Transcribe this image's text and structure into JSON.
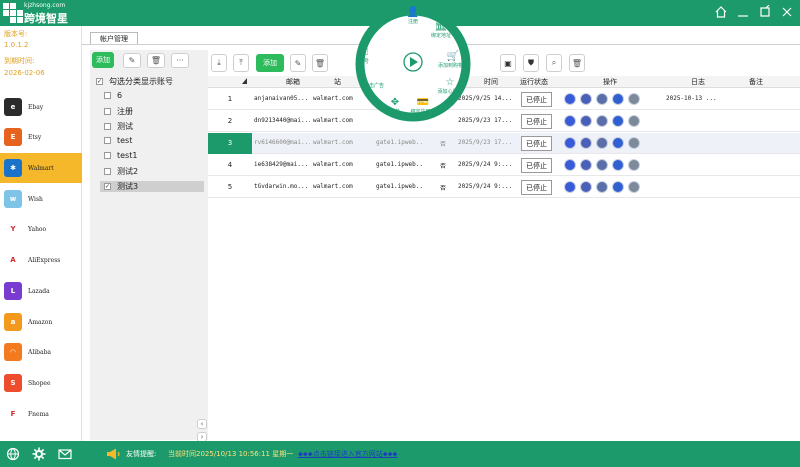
{
  "app": {
    "domain": "kjzhsong.com",
    "name": "跨境智星"
  },
  "version": {
    "label": "版本号:",
    "value": "1.0.1.2",
    "expire_label": "到期时间:",
    "expire_value": "2026-02-06"
  },
  "platforms": [
    {
      "name": "Ebay",
      "color": "#2b2b2b",
      "glyph": "e"
    },
    {
      "name": "Etsy",
      "color": "#e8621f",
      "glyph": "E"
    },
    {
      "name": "Walmart",
      "color": "#1a73c9",
      "glyph": "✱"
    },
    {
      "name": "Wish",
      "color": "#7ec4e6",
      "glyph": "w"
    },
    {
      "name": "Yahoo",
      "color": "#ffffff",
      "glyph": "Y"
    },
    {
      "name": "AliExpress",
      "color": "#ffffff",
      "glyph": "A"
    },
    {
      "name": "Lazada",
      "color": "#7a3bd1",
      "glyph": "L"
    },
    {
      "name": "Amazon",
      "color": "#f39a1e",
      "glyph": "a"
    },
    {
      "name": "Alibaba",
      "color": "#f37a1e",
      "glyph": "◠"
    },
    {
      "name": "Shopee",
      "color": "#ee4d2d",
      "glyph": "S"
    },
    {
      "name": "Fnema",
      "color": "#ffffff",
      "glyph": "F"
    }
  ],
  "active_platform": "Walmart",
  "tab": {
    "label": "帐户管理"
  },
  "category": {
    "add_label": "添加",
    "header": "勾选分类显示账号",
    "items": [
      {
        "label": "6",
        "checked": false
      },
      {
        "label": "注册",
        "checked": false
      },
      {
        "label": "测试",
        "checked": false
      },
      {
        "label": "test",
        "checked": false
      },
      {
        "label": "test1",
        "checked": false
      },
      {
        "label": "测试2",
        "checked": false
      },
      {
        "label": "测试3",
        "checked": true
      }
    ]
  },
  "toolbar": {
    "add_label": "添加"
  },
  "table": {
    "headers": {
      "email": "邮箱",
      "site": "站",
      "time": "时间",
      "status": "运行状态",
      "ops": "操作",
      "log": "日志",
      "note": "备注"
    },
    "rows": [
      {
        "num": "1",
        "email": "anjanaivan05...",
        "site": "walmart.com",
        "proxy": "",
        "flag": "",
        "time": "2025/9/25 14...",
        "status": "已停止",
        "log": "2025-10-13 ..."
      },
      {
        "num": "2",
        "email": "dn9213440@mai...",
        "site": "walmart.com",
        "proxy": "",
        "flag": "",
        "time": "2025/9/23 17...",
        "status": "已停止",
        "log": ""
      },
      {
        "num": "3",
        "email": "rv6146600@mai...",
        "site": "walmart.com",
        "proxy": "gate1.ipweb...",
        "flag": "否",
        "time": "2025/9/23 17...",
        "status": "已停止",
        "log": ""
      },
      {
        "num": "4",
        "email": "ie638429@mai...",
        "site": "walmart.com",
        "proxy": "gate1.ipweb...",
        "flag": "否",
        "time": "2025/9/24 9:...",
        "status": "已停止",
        "log": ""
      },
      {
        "num": "5",
        "email": "tGvdarwin.mo...",
        "site": "walmart.com",
        "proxy": "gate1.ipweb...",
        "flag": "否",
        "time": "2025/9/24 9:...",
        "status": "已停止",
        "log": ""
      }
    ]
  },
  "radial_menu": {
    "items": [
      "注册",
      "绑定地址",
      "添加到购物车",
      "添加心愿单",
      "绑定信用卡",
      "下单",
      "点击广告",
      "养号",
      "绑定邮箱"
    ]
  },
  "footer": {
    "notice_label": "友情提醒:",
    "time_text": "当前时间2025/10/13 10:56:11 星期一",
    "link_text": "⬥⬥⬥点击链接进入官方网站⬥⬥⬥"
  },
  "colors": {
    "primary": "#1d9a6c",
    "active": "#f5b82a",
    "add_button": "#2dbb5c"
  }
}
